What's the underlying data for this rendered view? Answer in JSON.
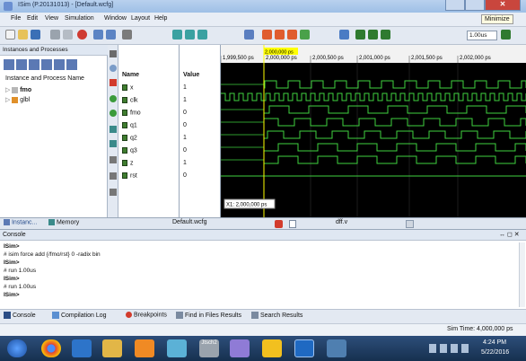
{
  "titlebar": {
    "title": "ISim (P.20131013) - [Default.wcfg]",
    "minimize_tooltip": "Minimize"
  },
  "menu": [
    "File",
    "Edit",
    "View",
    "Simulation",
    "Window",
    "Layout",
    "Help"
  ],
  "toolbar": {
    "run_time": "1.00us"
  },
  "instances": {
    "header": "Instances and Processes",
    "column": "Instance and Process Name",
    "items": [
      {
        "label": "fmo"
      },
      {
        "label": "glbl"
      }
    ]
  },
  "wave": {
    "name_header": "Name",
    "value_header": "Value",
    "signals": [
      {
        "name": "x",
        "value": "1"
      },
      {
        "name": "clk",
        "value": "1"
      },
      {
        "name": "fmo",
        "value": "0"
      },
      {
        "name": "q1",
        "value": "0"
      },
      {
        "name": "q2",
        "value": "1"
      },
      {
        "name": "q3",
        "value": "0"
      },
      {
        "name": "z",
        "value": "1"
      },
      {
        "name": "rst",
        "value": "0"
      }
    ],
    "time_labels": [
      "1,999,500 ps",
      "2,000,000 ps",
      "2,000,500 ps",
      "2,001,000 ps",
      "2,001,500 ps",
      "2,002,000 ps"
    ],
    "cursor_label": "2,000,000 ps",
    "cursor_readout": "X1: 2,000,000 ps"
  },
  "bottom_tabs": {
    "instances": "Instanc...",
    "memory": "Memory",
    "wcfg": "Default.wcfg",
    "source": "dff.v"
  },
  "console": {
    "header": "Console",
    "lines": [
      "ISim>",
      "# isim force add {/fmo/rst} 0 -radix bin",
      "ISim>",
      "# run 1.00us",
      "ISim>",
      "# run 1.00us",
      "ISim>"
    ],
    "bold_lines": [
      0,
      2,
      4,
      6
    ],
    "tabs": [
      "Console",
      "Compilation Log",
      "Breakpoints",
      "Find in Files Results",
      "Search Results"
    ]
  },
  "status": {
    "sim_time": "Sim Time: 4,000,000 ps"
  },
  "taskbar": {
    "time": "4:24 PM",
    "date": "5/22/2016",
    "app_label": "Jtsch2"
  }
}
